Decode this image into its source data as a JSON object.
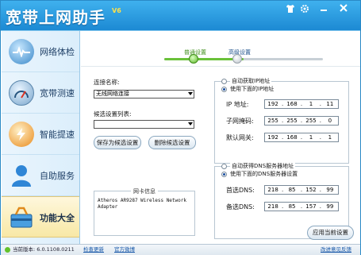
{
  "app": {
    "title": "宽带上网助手",
    "version_badge": "V6"
  },
  "titlebar_icons": [
    "tshirt-icon",
    "gear-icon",
    "minimize-icon",
    "close-icon"
  ],
  "sidebar": {
    "items": [
      {
        "label": "网络体检",
        "icon": "heartbeat-icon"
      },
      {
        "label": "宽带测速",
        "icon": "speedometer-icon"
      },
      {
        "label": "智能提速",
        "icon": "speedup-icon"
      },
      {
        "label": "自助服务",
        "icon": "user-service-icon"
      },
      {
        "label": "功能大全",
        "icon": "toolbox-icon",
        "active": true
      }
    ]
  },
  "steps": {
    "step1": "普通设置",
    "step2": "高级设置",
    "progress_fraction": 0.5
  },
  "form": {
    "connection_label": "连接名称:",
    "connection_value": "无线网络连接",
    "preset_label": "候选设置列表:",
    "preset_value": "",
    "save_preset": "保存为候选设置",
    "delete_preset": "删除候选设置",
    "netcard_title": "网卡信息",
    "netcard_info": "Atheros AR9287 Wireless Network Adapter"
  },
  "ip_group": {
    "auto_label": "自动获取IP地址",
    "manual_label": "使用下面的IP地址",
    "selected": "manual",
    "ip_label": "IP 地址:",
    "ip": [
      "192",
      "168",
      "1",
      "11"
    ],
    "mask_label": "子网掩码:",
    "mask": [
      "255",
      "255",
      "255",
      "0"
    ],
    "gateway_label": "默认网关:",
    "gateway": [
      "192",
      "168",
      "1",
      "1"
    ]
  },
  "dns_group": {
    "auto_label": "自动获得DNS服务器地址",
    "manual_label": "使用下面的DNS服务器设置",
    "selected": "manual",
    "primary_label": "首选DNS:",
    "primary": [
      "218",
      "85",
      "152",
      "99"
    ],
    "secondary_label": "备选DNS:",
    "secondary": [
      "218",
      "85",
      "157",
      "99"
    ]
  },
  "apply_button": "应用当前设置",
  "status": {
    "version": "当前版本: 6.0.1108.0211",
    "check_update": "检查更新",
    "official_weibo": "官方微博",
    "feedback": "改进意见反馈"
  },
  "colors": {
    "titlebar": "#2a9de0",
    "accent_green": "#6ac13a",
    "active_nav": "#f8e8a6"
  }
}
